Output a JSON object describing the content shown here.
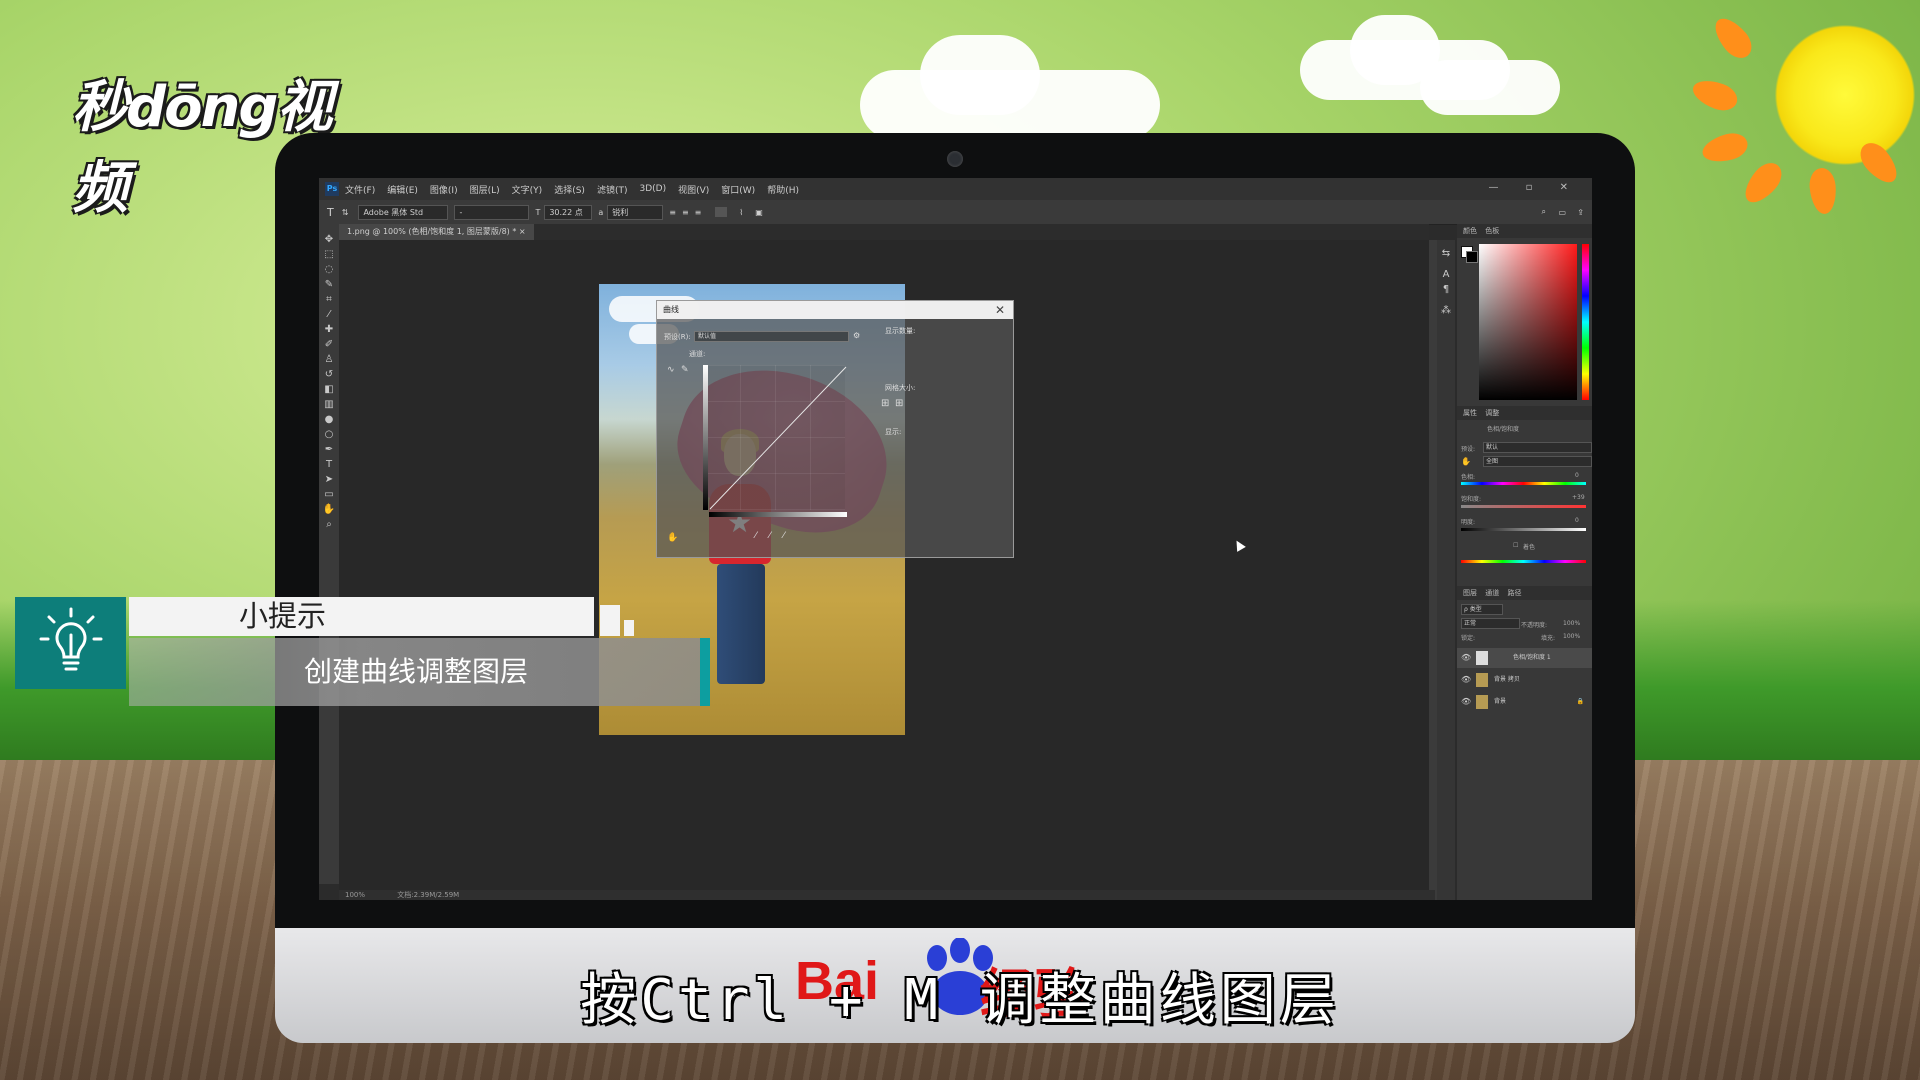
{
  "site": {
    "logo_text": "秒dōng视频"
  },
  "photoshop": {
    "app_badge": "Ps",
    "menu": [
      "文件(F)",
      "编辑(E)",
      "图像(I)",
      "图层(L)",
      "文字(Y)",
      "选择(S)",
      "滤镜(T)",
      "3D(D)",
      "视图(V)",
      "窗口(W)",
      "帮助(H)"
    ],
    "window_controls": "— ▫ ✕",
    "options": {
      "font_family": "Adobe 黑体 Std",
      "font_style": "-",
      "font_size": "30.22 点",
      "anti_alias": "锐利"
    },
    "doc_tab": "1.png @ 100% (色相/饱和度 1, 图层蒙版/8) * ×",
    "status": {
      "zoom": "100%",
      "doc_size": "文档:2.39M/2.59M"
    },
    "curves_dialog": {
      "title": "曲线",
      "close": "✕",
      "preset_label": "预设(R):",
      "preset_value": "默认值",
      "channel_label": "通道:",
      "show_amount_label": "显示数量:",
      "grid_size_label": "网格大小:",
      "show_label": "显示:"
    },
    "panels": {
      "color_tabs": [
        "颜色",
        "色板"
      ],
      "properties_tabs": [
        "属性",
        "调整"
      ],
      "properties_title": "色相/饱和度",
      "preset_label": "预设:",
      "preset_value": "默认",
      "channel_value": "全图",
      "hue_label": "色相:",
      "hue_value": "0",
      "saturation_label": "饱和度:",
      "saturation_value": "+39",
      "lightness_label": "明度:",
      "lightness_value": "0",
      "colorize_label": "着色",
      "layers_tabs": [
        "图层",
        "通道",
        "路径"
      ],
      "kind_label": "ρ 类型",
      "blend_mode": "正常",
      "opacity_label": "不透明度:",
      "opacity_value": "100%",
      "lock_label": "锁定:",
      "fill_label": "填充:",
      "fill_value": "100%",
      "layers": [
        {
          "name": "色相/饱和度 1"
        },
        {
          "name": "背景 拷贝"
        },
        {
          "name": "背景"
        }
      ]
    }
  },
  "tip": {
    "title": "小提示",
    "text": "创建曲线调整图层"
  },
  "watermark": {
    "left": "Bai",
    "right": "经验"
  },
  "subtitle": "按Ctrl + M 调整曲线图层"
}
